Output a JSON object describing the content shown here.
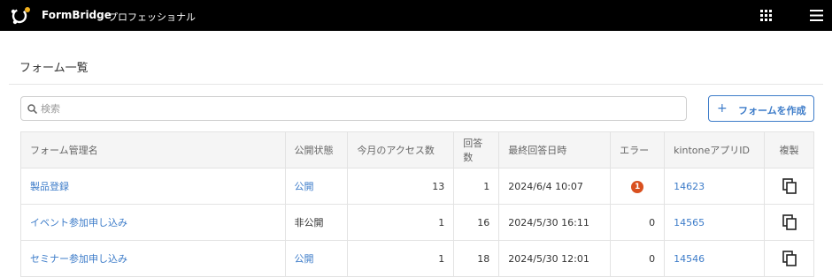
{
  "header": {
    "brand": "FormBridge",
    "edition": "プロフェッショナル"
  },
  "page": {
    "title": "フォーム一覧"
  },
  "search": {
    "placeholder": "検索",
    "value": ""
  },
  "actions": {
    "create_plus": "+",
    "create_label": "フォームを作成"
  },
  "table": {
    "columns": [
      "フォーム管理名",
      "公開状態",
      "今月のアクセス数",
      "回答数",
      "最終回答日時",
      "エラー",
      "kintoneアプリID",
      "複製"
    ],
    "rows": [
      {
        "name": "製品登録",
        "status": "公開",
        "access": "13",
        "answers": "1",
        "last": "2024/6/4 10:07",
        "error": "1",
        "app_id": "14623"
      },
      {
        "name": "イベント参加申し込み",
        "status": "非公開",
        "access": "1",
        "answers": "16",
        "last": "2024/5/30 16:11",
        "error": "0",
        "app_id": "14565"
      },
      {
        "name": "セミナー参加申し込み",
        "status": "公開",
        "access": "1",
        "answers": "18",
        "last": "2024/5/30 12:01",
        "error": "0",
        "app_id": "14546"
      }
    ]
  },
  "colors": {
    "accent": "#3d7cc9",
    "error_badge": "#d9501f",
    "topbar": "#000000"
  },
  "icons": {
    "logo": "formbridge-logo-icon",
    "apps": "grid-icon",
    "menu": "hamburger-menu-icon",
    "search": "search-icon",
    "copy": "copy-icon"
  }
}
